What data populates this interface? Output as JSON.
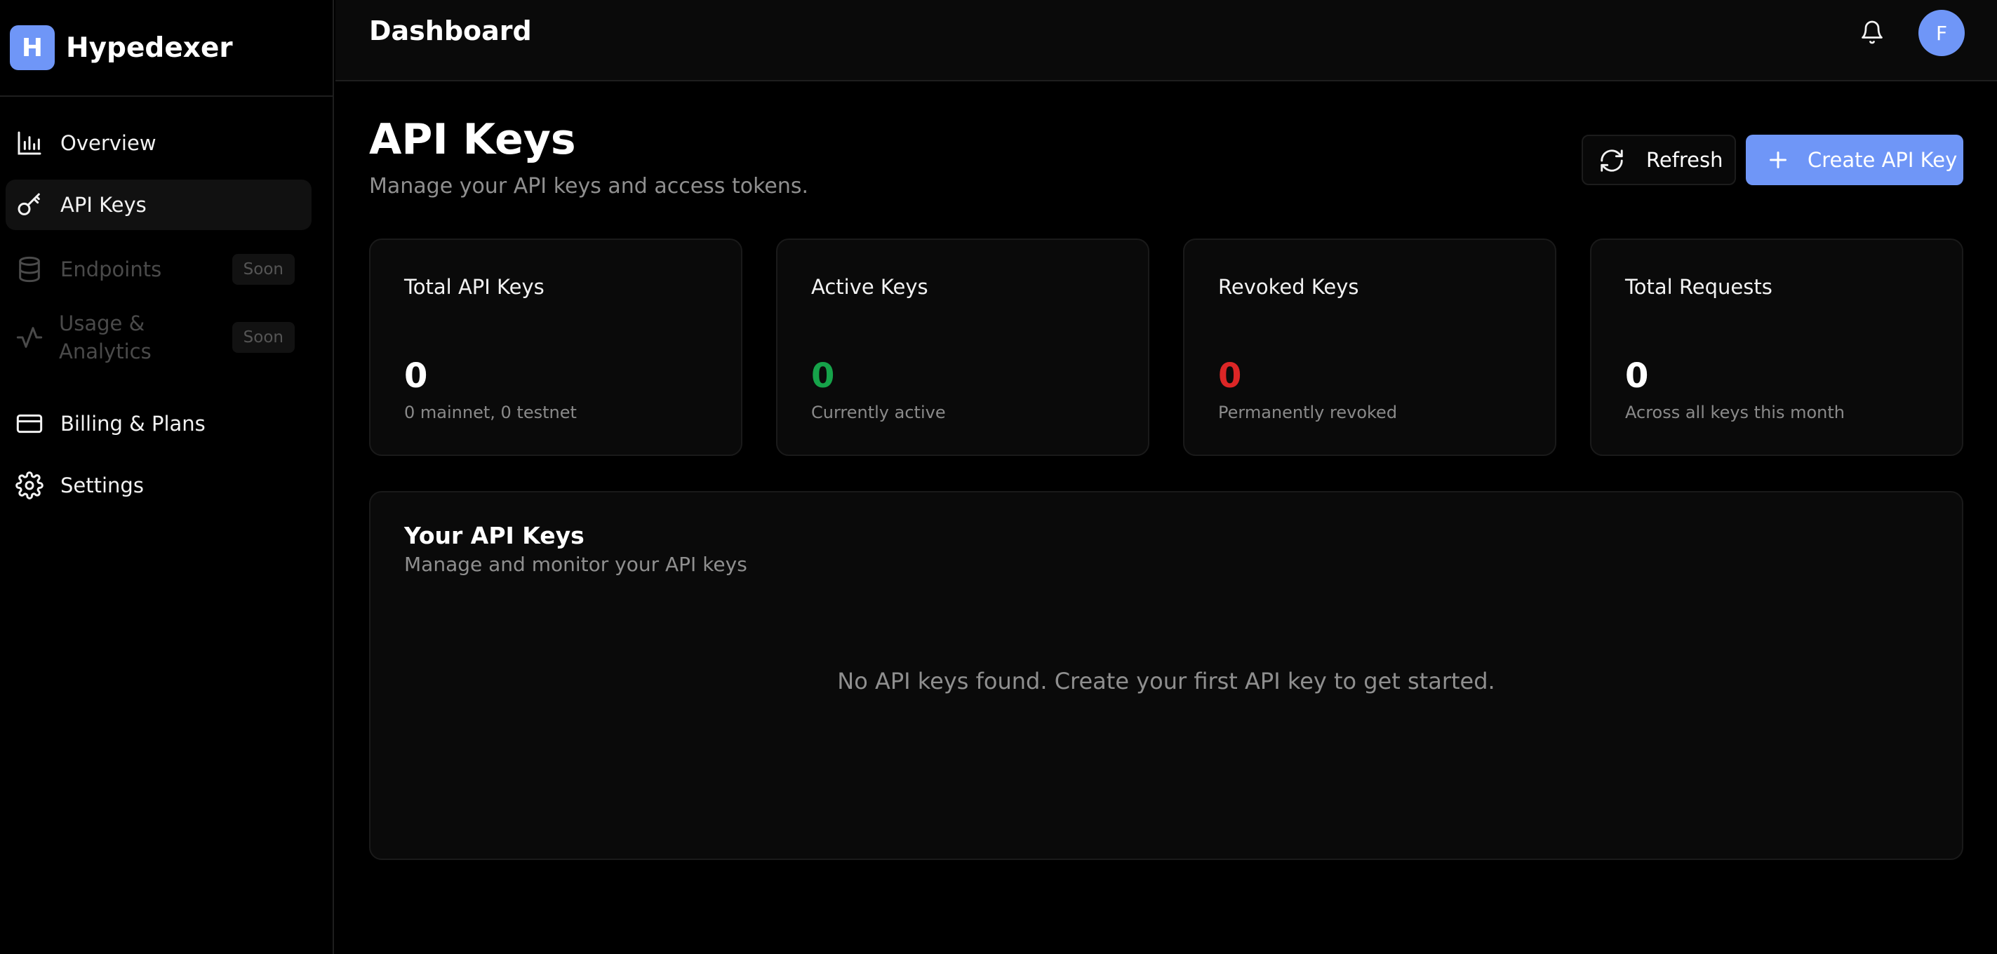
{
  "brand": {
    "initial": "H",
    "name": "Hypedexer"
  },
  "sidebar": {
    "items": [
      {
        "label": "Overview",
        "icon": "bar-chart-icon",
        "state": "normal"
      },
      {
        "label": "API Keys",
        "icon": "key-icon",
        "state": "active"
      },
      {
        "label": "Endpoints",
        "icon": "database-icon",
        "state": "disabled",
        "badge": "Soon"
      },
      {
        "label_line1": "Usage &",
        "label_line2": "Analytics",
        "icon": "activity-icon",
        "state": "disabled",
        "badge": "Soon"
      },
      {
        "label": "Billing & Plans",
        "icon": "credit-card-icon",
        "state": "normal"
      },
      {
        "label": "Settings",
        "icon": "gear-icon",
        "state": "normal"
      }
    ]
  },
  "header": {
    "title": "Dashboard",
    "avatar_initial": "F"
  },
  "page": {
    "title": "API Keys",
    "subtitle": "Manage your API keys and access tokens.",
    "refresh_label": "Refresh",
    "create_label": "Create API Key"
  },
  "stats": [
    {
      "title": "Total API Keys",
      "value": "0",
      "note": "0 mainnet, 0 testnet",
      "color": "#ffffff"
    },
    {
      "title": "Active Keys",
      "value": "0",
      "note": "Currently active",
      "color": "#16a34a"
    },
    {
      "title": "Revoked Keys",
      "value": "0",
      "note": "Permanently revoked",
      "color": "#dc2626"
    },
    {
      "title": "Total Requests",
      "value": "0",
      "note": "Across all keys this month",
      "color": "#ffffff"
    }
  ],
  "keys_card": {
    "title": "Your API Keys",
    "subtitle": "Manage and monitor your API keys",
    "empty_message": "No API keys found. Create your first API key to get started."
  },
  "colors": {
    "accent": "#6f96f7",
    "background": "#000000",
    "card": "#0a0a0a"
  }
}
